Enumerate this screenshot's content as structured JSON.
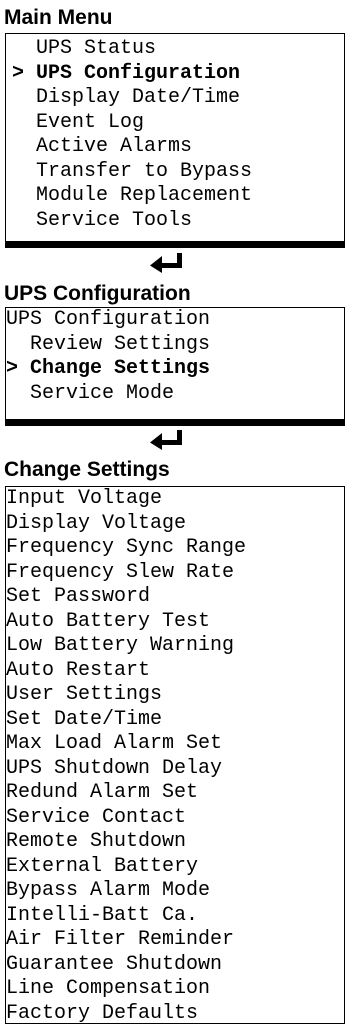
{
  "main_menu": {
    "title": "Main Menu",
    "items": [
      "  UPS Status",
      "> UPS Configuration",
      "  Display Date/Time",
      "  Event Log",
      "  Active Alarms",
      "  Transfer to Bypass",
      "  Module Replacement",
      "  Service Tools"
    ],
    "selected_index": 1
  },
  "ups_configuration": {
    "title": "UPS Configuration",
    "items": [
      "UPS Configuration",
      "  Review Settings",
      "> Change Settings",
      "  Service Mode"
    ],
    "selected_index": 2
  },
  "change_settings": {
    "title": "Change Settings",
    "items": [
      "Input Voltage",
      "Display Voltage",
      "Frequency Sync Range",
      "Frequency Slew Rate",
      "Set Password",
      "Auto Battery Test",
      "Low Battery Warning",
      "Auto Restart",
      "User Settings",
      "Set Date/Time",
      "Max Load Alarm Set",
      "UPS Shutdown Delay",
      "Redund Alarm Set",
      "Service Contact",
      "Remote Shutdown",
      "External Battery",
      "Bypass Alarm Mode",
      "Intelli-Batt Ca.",
      "Air Filter Reminder",
      "Guarantee Shutdown",
      "Line Compensation",
      "Factory Defaults"
    ]
  },
  "icons": {
    "enter": "enter-arrow-icon"
  }
}
